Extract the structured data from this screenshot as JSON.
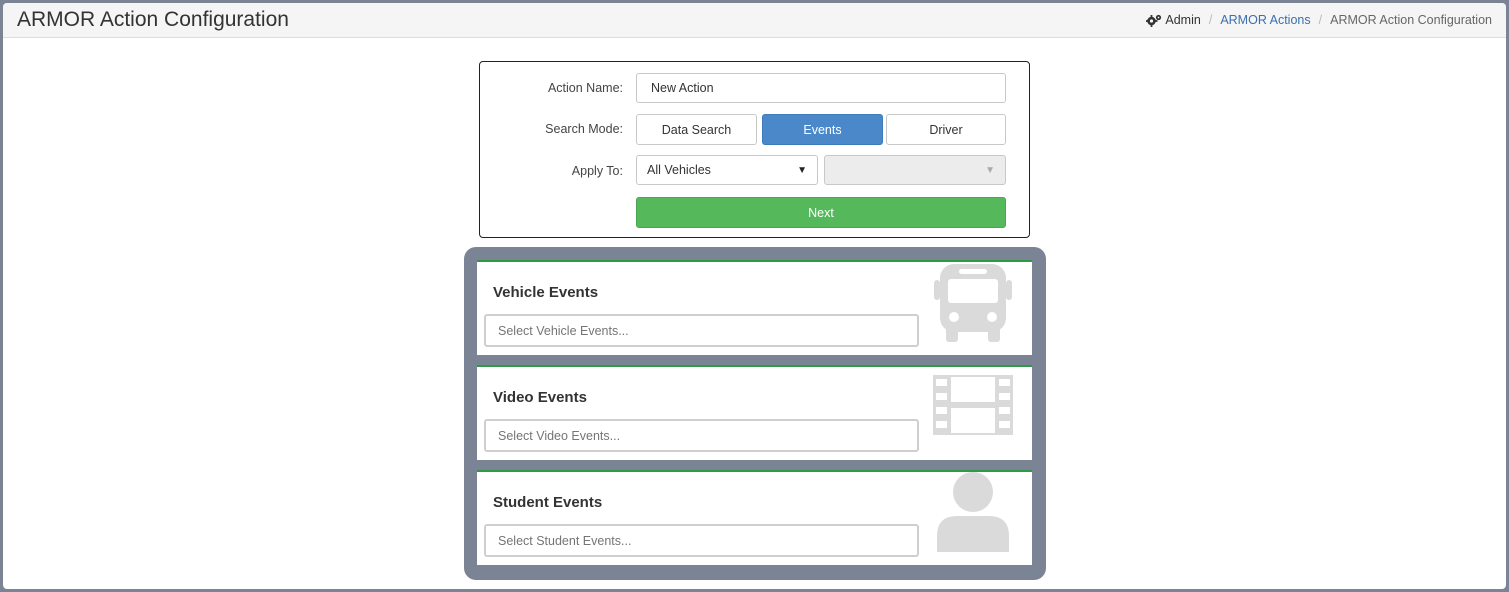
{
  "header": {
    "title": "ARMOR Action Configuration",
    "breadcrumb": {
      "admin": "Admin",
      "actions_link": "ARMOR Actions",
      "current": "ARMOR Action Configuration",
      "separator": "/"
    }
  },
  "form": {
    "action_name_label": "Action Name:",
    "action_name_value": "New Action",
    "search_mode_label": "Search Mode:",
    "search_modes": [
      "Data Search",
      "Events",
      "Driver"
    ],
    "active_mode": "Events",
    "apply_to_label": "Apply To:",
    "apply_to_value": "All Vehicles",
    "apply_to_secondary_value": "",
    "next_label": "Next"
  },
  "events": [
    {
      "title": "Vehicle Events",
      "placeholder": "Select Vehicle Events...",
      "icon": "bus-icon"
    },
    {
      "title": "Video Events",
      "placeholder": "Select Video Events...",
      "icon": "film-icon"
    },
    {
      "title": "Student Events",
      "placeholder": "Select Student Events...",
      "icon": "user-icon"
    }
  ],
  "colors": {
    "primary": "#4a88c9",
    "success": "#55b95c",
    "card_accent": "#2e9a44",
    "container": "#7a8494",
    "link": "#3a6fb0"
  }
}
